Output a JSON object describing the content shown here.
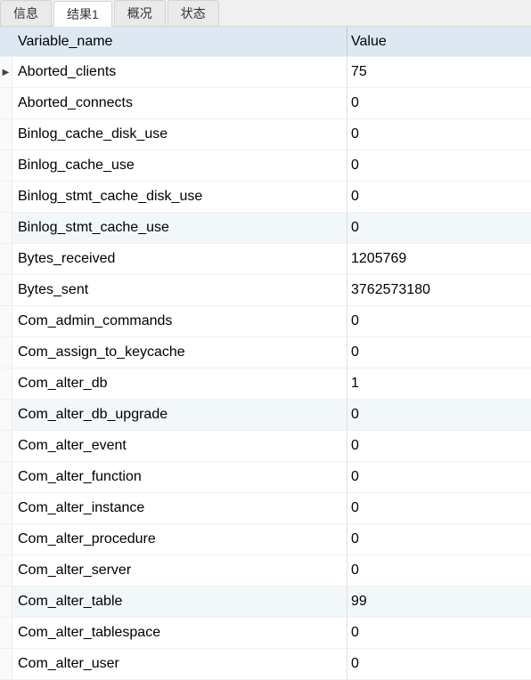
{
  "tabs": {
    "items": [
      {
        "label": "信息",
        "active": false
      },
      {
        "label": "结果1",
        "active": true
      },
      {
        "label": "概况",
        "active": false
      },
      {
        "label": "状态",
        "active": false
      }
    ]
  },
  "table": {
    "header": {
      "col1": "Variable_name",
      "col2": "Value"
    },
    "rows": [
      {
        "name": "Aborted_clients",
        "value": "75",
        "current": true,
        "alt": false
      },
      {
        "name": "Aborted_connects",
        "value": "0",
        "current": false,
        "alt": false
      },
      {
        "name": "Binlog_cache_disk_use",
        "value": "0",
        "current": false,
        "alt": false
      },
      {
        "name": "Binlog_cache_use",
        "value": "0",
        "current": false,
        "alt": false
      },
      {
        "name": "Binlog_stmt_cache_disk_use",
        "value": "0",
        "current": false,
        "alt": false
      },
      {
        "name": "Binlog_stmt_cache_use",
        "value": "0",
        "current": false,
        "alt": true
      },
      {
        "name": "Bytes_received",
        "value": "1205769",
        "current": false,
        "alt": false
      },
      {
        "name": "Bytes_sent",
        "value": "3762573180",
        "current": false,
        "alt": false
      },
      {
        "name": "Com_admin_commands",
        "value": "0",
        "current": false,
        "alt": false
      },
      {
        "name": "Com_assign_to_keycache",
        "value": "0",
        "current": false,
        "alt": false
      },
      {
        "name": "Com_alter_db",
        "value": "1",
        "current": false,
        "alt": false
      },
      {
        "name": "Com_alter_db_upgrade",
        "value": "0",
        "current": false,
        "alt": true
      },
      {
        "name": "Com_alter_event",
        "value": "0",
        "current": false,
        "alt": false
      },
      {
        "name": "Com_alter_function",
        "value": "0",
        "current": false,
        "alt": false
      },
      {
        "name": "Com_alter_instance",
        "value": "0",
        "current": false,
        "alt": false
      },
      {
        "name": "Com_alter_procedure",
        "value": "0",
        "current": false,
        "alt": false
      },
      {
        "name": "Com_alter_server",
        "value": "0",
        "current": false,
        "alt": false
      },
      {
        "name": "Com_alter_table",
        "value": "99",
        "current": false,
        "alt": true
      },
      {
        "name": "Com_alter_tablespace",
        "value": "0",
        "current": false,
        "alt": false
      },
      {
        "name": "Com_alter_user",
        "value": "0",
        "current": false,
        "alt": false
      }
    ]
  }
}
